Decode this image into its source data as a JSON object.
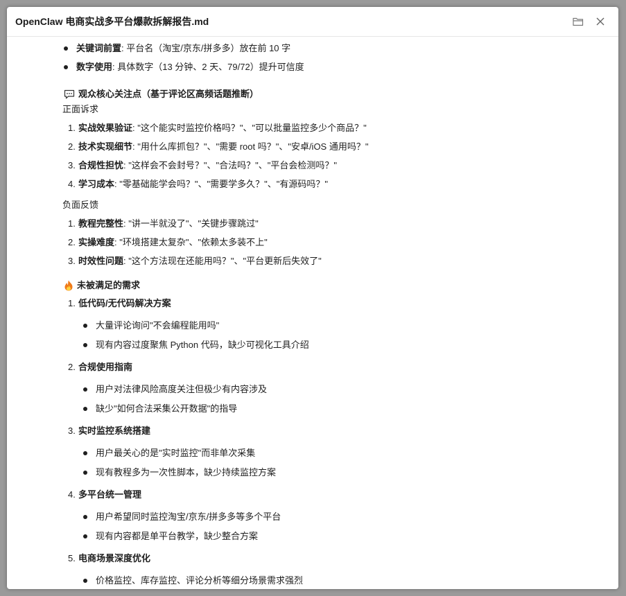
{
  "window": {
    "title": "OpenClaw 电商实战多平台爆款拆解报告.md"
  },
  "top_bullets": [
    {
      "label": "关键词前置",
      "text": ": 平台名（淘宝/京东/拼多多）放在前 10 字"
    },
    {
      "label": "数字使用",
      "text": ": 具体数字（13 分钟、2 天、79/72）提升可信度"
    }
  ],
  "audience": {
    "heading": "观众核心关注点（基于评论区高频话题推断）",
    "positive_label": "正面诉求",
    "positive": [
      {
        "num": "1.",
        "label": "实战效果验证",
        "text": ": \"这个能实时监控价格吗？\"、\"可以批量监控多少个商品？\""
      },
      {
        "num": "2.",
        "label": "技术实现细节",
        "text": ": \"用什么库抓包？\"、\"需要 root 吗？\"、\"安卓/iOS 通用吗？\""
      },
      {
        "num": "3.",
        "label": "合规性担忧",
        "text": ": \"这样会不会封号？\"、\"合法吗？\"、\"平台会检测吗？\""
      },
      {
        "num": "4.",
        "label": "学习成本",
        "text": ": \"零基础能学会吗？\"、\"需要学多久？\"、\"有源码吗？\""
      }
    ],
    "negative_label": "负面反馈",
    "negative": [
      {
        "num": "1.",
        "label": "教程完整性",
        "text": ": \"讲一半就没了\"、\"关键步骤跳过\""
      },
      {
        "num": "2.",
        "label": "实操难度",
        "text": ": \"环境搭建太复杂\"、\"依赖太多装不上\""
      },
      {
        "num": "3.",
        "label": "时效性问题",
        "text": ": \"这个方法现在还能用吗？\"、\"平台更新后失效了\""
      }
    ]
  },
  "unmet": {
    "heading": "未被满足的需求",
    "items": [
      {
        "num": "1.",
        "title": "低代码/无代码解决方案",
        "bullets": [
          "大量评论询问\"不会编程能用吗\"",
          "现有内容过度聚焦 Python 代码，缺少可视化工具介绍"
        ]
      },
      {
        "num": "2.",
        "title": "合规使用指南",
        "bullets": [
          "用户对法律风险高度关注但极少有内容涉及",
          "缺少\"如何合法采集公开数据\"的指导"
        ]
      },
      {
        "num": "3.",
        "title": "实时监控系统搭建",
        "bullets": [
          "用户最关心的是\"实时监控\"而非单次采集",
          "现有教程多为一次性脚本，缺少持续监控方案"
        ]
      },
      {
        "num": "4.",
        "title": "多平台统一管理",
        "bullets": [
          "用户希望同时监控淘宝/京东/拼多多等多个平台",
          "现有内容都是单平台教学，缺少整合方案"
        ]
      },
      {
        "num": "5.",
        "title": "电商场景深度优化",
        "bullets": [
          "价格监控、库存监控、评论分析等细分场景需求强烈"
        ]
      }
    ]
  },
  "icons": {
    "folder": "folder-icon",
    "close": "close-icon",
    "chat": "speech-bubble-icon",
    "fire": "fire-icon"
  }
}
